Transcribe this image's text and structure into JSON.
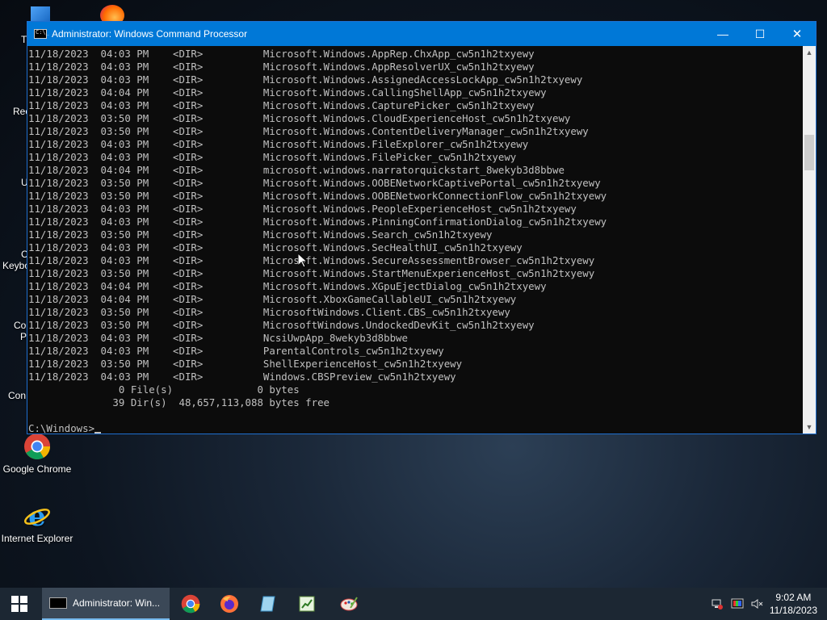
{
  "desktop": {
    "icons": [
      {
        "label": "Google Chrome"
      },
      {
        "label": "Internet Explorer"
      }
    ],
    "partial_labels": [
      "T",
      "Rec",
      "U",
      "C",
      "Keybo",
      "Co",
      "P",
      "Con"
    ]
  },
  "window": {
    "title": "Administrator: Windows Command Processor",
    "minimize_glyph": "—",
    "maximize_glyph": "☐",
    "close_glyph": "✕"
  },
  "console": {
    "lines": [
      "11/18/2023  04:03 PM    <DIR>          Microsoft.Windows.AppRep.ChxApp_cw5n1h2txyewy",
      "11/18/2023  04:03 PM    <DIR>          Microsoft.Windows.AppResolverUX_cw5n1h2txyewy",
      "11/18/2023  04:03 PM    <DIR>          Microsoft.Windows.AssignedAccessLockApp_cw5n1h2txyewy",
      "11/18/2023  04:04 PM    <DIR>          Microsoft.Windows.CallingShellApp_cw5n1h2txyewy",
      "11/18/2023  04:03 PM    <DIR>          Microsoft.Windows.CapturePicker_cw5n1h2txyewy",
      "11/18/2023  03:50 PM    <DIR>          Microsoft.Windows.CloudExperienceHost_cw5n1h2txyewy",
      "11/18/2023  03:50 PM    <DIR>          Microsoft.Windows.ContentDeliveryManager_cw5n1h2txyewy",
      "11/18/2023  04:03 PM    <DIR>          Microsoft.Windows.FileExplorer_cw5n1h2txyewy",
      "11/18/2023  04:03 PM    <DIR>          Microsoft.Windows.FilePicker_cw5n1h2txyewy",
      "11/18/2023  04:04 PM    <DIR>          microsoft.windows.narratorquickstart_8wekyb3d8bbwe",
      "11/18/2023  03:50 PM    <DIR>          Microsoft.Windows.OOBENetworkCaptivePortal_cw5n1h2txyewy",
      "11/18/2023  03:50 PM    <DIR>          Microsoft.Windows.OOBENetworkConnectionFlow_cw5n1h2txyewy",
      "11/18/2023  04:03 PM    <DIR>          Microsoft.Windows.PeopleExperienceHost_cw5n1h2txyewy",
      "11/18/2023  04:03 PM    <DIR>          Microsoft.Windows.PinningConfirmationDialog_cw5n1h2txyewy",
      "11/18/2023  03:50 PM    <DIR>          Microsoft.Windows.Search_cw5n1h2txyewy",
      "11/18/2023  04:03 PM    <DIR>          Microsoft.Windows.SecHealthUI_cw5n1h2txyewy",
      "11/18/2023  04:03 PM    <DIR>          Microsoft.Windows.SecureAssessmentBrowser_cw5n1h2txyewy",
      "11/18/2023  03:50 PM    <DIR>          Microsoft.Windows.StartMenuExperienceHost_cw5n1h2txyewy",
      "11/18/2023  04:04 PM    <DIR>          Microsoft.Windows.XGpuEjectDialog_cw5n1h2txyewy",
      "11/18/2023  04:04 PM    <DIR>          Microsoft.XboxGameCallableUI_cw5n1h2txyewy",
      "11/18/2023  03:50 PM    <DIR>          MicrosoftWindows.Client.CBS_cw5n1h2txyewy",
      "11/18/2023  03:50 PM    <DIR>          MicrosoftWindows.UndockedDevKit_cw5n1h2txyewy",
      "11/18/2023  04:03 PM    <DIR>          NcsiUwpApp_8wekyb3d8bbwe",
      "11/18/2023  04:03 PM    <DIR>          ParentalControls_cw5n1h2txyewy",
      "11/18/2023  03:50 PM    <DIR>          ShellExperienceHost_cw5n1h2txyewy",
      "11/18/2023  04:03 PM    <DIR>          Windows.CBSPreview_cw5n1h2txyewy",
      "               0 File(s)              0 bytes",
      "              39 Dir(s)  48,657,113,088 bytes free",
      "",
      "C:\\Windows>"
    ],
    "text_color": "#c0c0c0",
    "background_color": "#0c0c0c"
  },
  "taskbar": {
    "active_task_label": "Administrator: Win...",
    "pinned": [
      "chrome-icon",
      "firefox-icon",
      "notepad-plus-plus-icon",
      "spreadsheet-icon",
      "paint-icon"
    ],
    "clock": {
      "time": "9:02 AM",
      "date": "11/18/2023"
    },
    "accent": "#0078d7"
  }
}
